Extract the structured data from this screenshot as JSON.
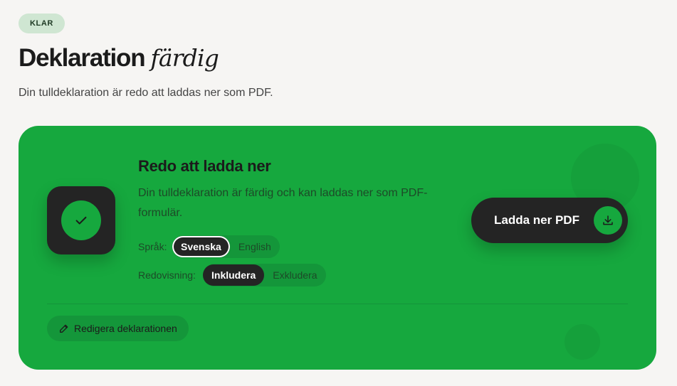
{
  "status_badge": "KLAR",
  "header": {
    "title": "Deklaration",
    "title_accent": "färdig",
    "subtitle": "Din tulldeklaration är redo att laddas ner som PDF."
  },
  "card": {
    "title": "Redo att ladda ner",
    "description": "Din tulldeklaration är färdig och kan laddas ner som PDF-formulär.",
    "language": {
      "label": "Språk:",
      "options": [
        "Svenska",
        "English"
      ],
      "selected": "Svenska"
    },
    "disclosure": {
      "label": "Redovisning:",
      "options": [
        "Inkludera",
        "Exkludera"
      ],
      "selected": "Inkludera"
    },
    "download_label": "Ladda ner PDF",
    "edit_label": "Redigera deklarationen"
  },
  "icons": {
    "status": "check-icon",
    "download": "download-icon",
    "edit": "pencil-icon"
  },
  "colors": {
    "accent": "#16a83e",
    "dark": "#242424",
    "badge_bg": "#cfe6d2",
    "background": "#f6f5f3"
  }
}
